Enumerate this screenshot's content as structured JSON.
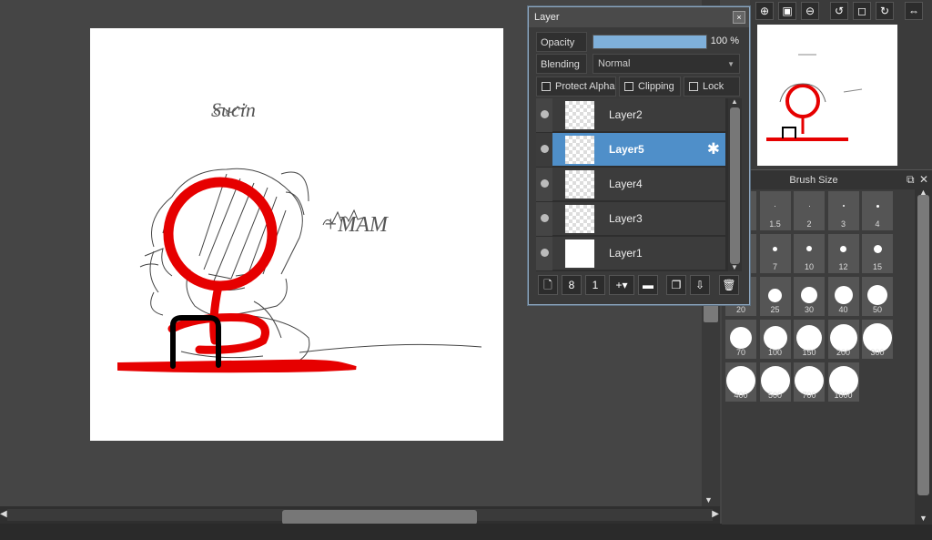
{
  "layer_panel": {
    "title": "Layer",
    "opacity_label": "Opacity",
    "opacity_value": "100 %",
    "opacity_fraction": 1.0,
    "blending_label": "Blending",
    "blending_value": "Normal",
    "protect_alpha_label": "Protect Alpha",
    "clipping_label": "Clipping",
    "lock_label": "Lock",
    "layers": [
      {
        "name": "Layer2",
        "selected": false
      },
      {
        "name": "Layer5",
        "selected": true
      },
      {
        "name": "Layer4",
        "selected": false
      },
      {
        "name": "Layer3",
        "selected": false
      },
      {
        "name": "Layer1",
        "selected": false
      }
    ],
    "tool_icons": [
      "new-layer-icon",
      "new-8bit-layer-icon",
      "new-1bit-layer-icon",
      "add-layer-menu-icon",
      "new-folder-icon",
      "duplicate-layer-icon",
      "merge-down-icon",
      "delete-layer-icon"
    ]
  },
  "brush_panel": {
    "title": "Brush Size",
    "sizes": [
      "",
      "1.5",
      "2",
      "3",
      "4",
      "5",
      "7",
      "10",
      "12",
      "15",
      "20",
      "25",
      "30",
      "40",
      "50",
      "70",
      "100",
      "150",
      "200",
      "300",
      "400",
      "500",
      "700",
      "1000"
    ]
  },
  "canvas": {
    "text_sketch_1": "Sucin",
    "text_sketch_2": "+MAM"
  },
  "navigator": {
    "tool_icons": [
      "zoom-in-icon",
      "fit-screen-icon",
      "zoom-out-icon",
      "rotate-left-icon",
      "actual-size-icon",
      "rotate-right-icon",
      "flip-icon"
    ]
  },
  "colors": {
    "accent": "#4f8fc9",
    "stroke_red": "#e60000"
  }
}
